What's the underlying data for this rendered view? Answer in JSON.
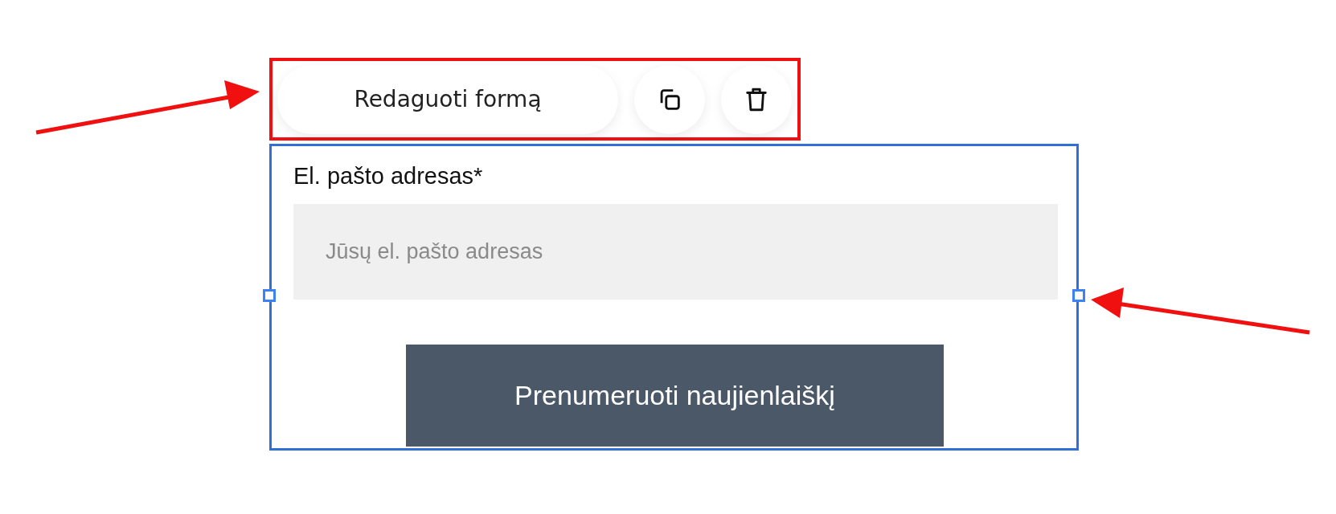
{
  "toolbar": {
    "edit_button": "Redaguoti formą",
    "highlighted": true
  },
  "form": {
    "selected": true,
    "email_label": "El. pašto adresas*",
    "email_field": {
      "placeholder": "Jūsų el. pašto adresas"
    },
    "submit_button": "Prenumeruoti naujienlaiškį"
  }
}
